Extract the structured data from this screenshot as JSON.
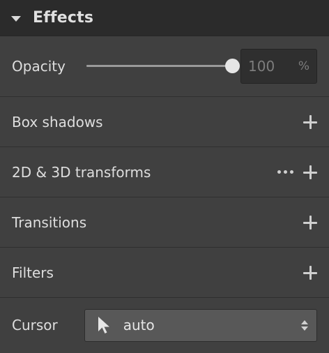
{
  "header": {
    "title": "Effects"
  },
  "opacity": {
    "label": "Opacity",
    "value": "100",
    "unit": "%",
    "slider_fraction": 1.0
  },
  "rows": [
    {
      "label": "Box shadows"
    },
    {
      "label": "2D & 3D transforms"
    },
    {
      "label": "Transitions"
    },
    {
      "label": "Filters"
    }
  ],
  "cursor": {
    "label": "Cursor",
    "value": "auto",
    "icon": "pointer-arrow-icon"
  },
  "colors": {
    "panel": "#404040",
    "header": "#2b2b2b",
    "text": "#dedede"
  }
}
